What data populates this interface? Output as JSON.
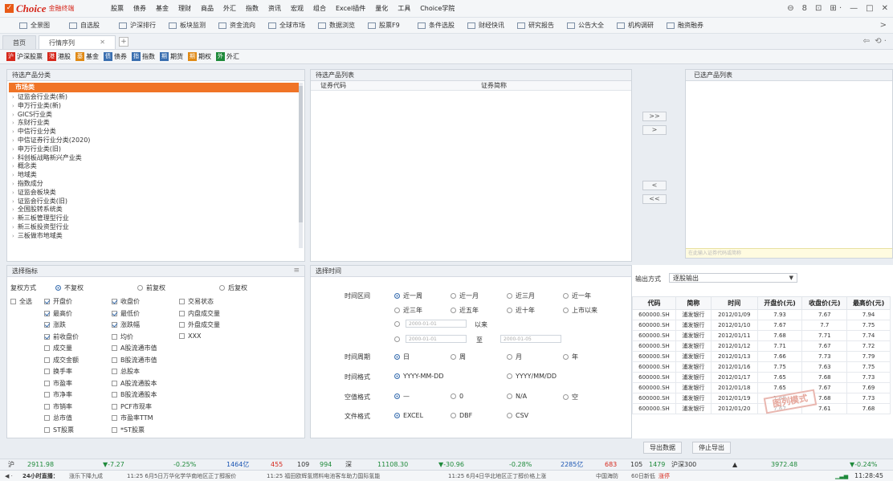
{
  "app": {
    "brand": "Choice",
    "brand_sub": "金融终端"
  },
  "menu": [
    "股票",
    "债券",
    "基金",
    "理财",
    "商品",
    "外汇",
    "指数",
    "资讯",
    "宏观",
    "组合",
    "Excel插件",
    "量化",
    "工具",
    "Choice学院"
  ],
  "window_controls": [
    "⊖",
    "8",
    "⊡",
    "⊞ ·",
    "—",
    "□",
    "✕"
  ],
  "toolbar": [
    "全景图",
    "自选股",
    "沪深排行",
    "板块监测",
    "资金流向",
    "全球市场",
    "数据浏览",
    "股票F9",
    "条件选股",
    "财经快讯",
    "研究报告",
    "公告大全",
    "机构调研",
    "融资融券"
  ],
  "toolbar_more": ">",
  "tabs": {
    "home": "首页",
    "active": "行情序列",
    "close": "✕",
    "add": "+"
  },
  "categories": [
    {
      "icon": "沪",
      "label": "沪深股票",
      "color": "#d6281c"
    },
    {
      "icon": "港",
      "label": "港股",
      "color": "#d6281c"
    },
    {
      "icon": "基",
      "label": "基金",
      "color": "#e08a16"
    },
    {
      "icon": "债",
      "label": "债券",
      "color": "#3a6fb0"
    },
    {
      "icon": "指",
      "label": "指数",
      "color": "#3a6fb0"
    },
    {
      "icon": "期",
      "label": "期货",
      "color": "#3a6fb0"
    },
    {
      "icon": "期",
      "label": "期权",
      "color": "#e08a16"
    },
    {
      "icon": "外",
      "label": "外汇",
      "color": "#1f8a3b"
    }
  ],
  "product_panel": {
    "title": "待选产品分类",
    "selected": "市场类",
    "items": [
      "证监会行业类(新)",
      "申万行业类(新)",
      "GICS行业类",
      "东财行业类",
      "中信行业分类",
      "中信证券行业分类(2020)",
      "申万行业类(旧)",
      "科创板战略新兴产业类",
      "概念类",
      "地域类",
      "指数成分",
      "证监会板块类",
      "证监会行业类(旧)",
      "全国股转系统类",
      "新三板管理型行业",
      "新三板投资型行业",
      "三板做市地域类"
    ]
  },
  "candidate_panel": {
    "title": "待选产品列表",
    "col_code": "证券代码",
    "col_name": "证券简称"
  },
  "chosen_panel": {
    "title": "已选产品列表",
    "placeholder": "在此输入证券代码或简称"
  },
  "arrow_buttons": [
    ">>",
    ">",
    "<",
    "<<"
  ],
  "indicator_panel": {
    "title": "选择指标",
    "rights_label": "复权方式",
    "rights": [
      {
        "label": "不复权",
        "on": true
      },
      {
        "label": "前复权",
        "on": false
      },
      {
        "label": "后复权",
        "on": false
      }
    ],
    "select_all": "全选",
    "col1": [
      {
        "label": "开盘价",
        "on": true
      },
      {
        "label": "最高价",
        "on": true
      },
      {
        "label": "涨跌",
        "on": true
      },
      {
        "label": "前收盘价",
        "on": true
      },
      {
        "label": "成交量",
        "on": false
      },
      {
        "label": "成交金额",
        "on": false
      },
      {
        "label": "换手率",
        "on": false
      },
      {
        "label": "市盈率",
        "on": false
      },
      {
        "label": "市净率",
        "on": false
      },
      {
        "label": "市销率",
        "on": false
      },
      {
        "label": "总市值",
        "on": false
      },
      {
        "label": "ST股票",
        "on": false
      }
    ],
    "col2": [
      {
        "label": "收盘价",
        "on": true
      },
      {
        "label": "最低价",
        "on": true
      },
      {
        "label": "涨跌幅",
        "on": true
      },
      {
        "label": "均价",
        "on": false
      },
      {
        "label": "A股流通市值",
        "on": false
      },
      {
        "label": "B股流通市值",
        "on": false
      },
      {
        "label": "总股本",
        "on": false
      },
      {
        "label": "A股流通股本",
        "on": false
      },
      {
        "label": "B股流通股本",
        "on": false
      },
      {
        "label": "PCF市现率",
        "on": false
      },
      {
        "label": "市盈率TTM",
        "on": false
      },
      {
        "label": "*ST股票",
        "on": false
      }
    ],
    "col3": [
      {
        "label": "交易状态",
        "on": false
      },
      {
        "label": "内盘成交量",
        "on": false
      },
      {
        "label": "外盘成交量",
        "on": false
      },
      {
        "label": "XXX",
        "on": false
      }
    ]
  },
  "time_panel": {
    "title": "选择时间",
    "range_label": "时间区间",
    "range_row1": [
      {
        "label": "近一周",
        "on": true
      },
      {
        "label": "近一月",
        "on": false
      },
      {
        "label": "近三月",
        "on": false
      },
      {
        "label": "近一年",
        "on": false
      }
    ],
    "range_row2": [
      {
        "label": "近三年",
        "on": false
      },
      {
        "label": "近五年",
        "on": false
      },
      {
        "label": "近十年",
        "on": false
      },
      {
        "label": "上市以来",
        "on": false
      }
    ],
    "date_from": "2000-01-01",
    "since": "以来",
    "date_to_start": "2000-01-01",
    "to": "至",
    "date_to_end": "2000-01-05",
    "period_label": "时间周期",
    "periods": [
      {
        "label": "日",
        "on": true
      },
      {
        "label": "周",
        "on": false
      },
      {
        "label": "月",
        "on": false
      },
      {
        "label": "年",
        "on": false
      }
    ],
    "format_label": "时间格式",
    "formats": [
      {
        "label": "YYYY-MM-DD",
        "on": true
      },
      {
        "label": "YYYY/MM/DD",
        "on": false
      }
    ],
    "empty_label": "空值格式",
    "empties": [
      {
        "label": "—",
        "on": true
      },
      {
        "label": "0",
        "on": false
      },
      {
        "label": "N/A",
        "on": false
      },
      {
        "label": "空",
        "on": false
      }
    ],
    "file_label": "文件格式",
    "files": [
      {
        "label": "EXCEL",
        "on": true
      },
      {
        "label": "DBF",
        "on": false
      },
      {
        "label": "CSV",
        "on": false
      }
    ]
  },
  "output_panel": {
    "mode_label": "输出方式",
    "mode_value": "逐股输出",
    "columns": [
      "代码",
      "简称",
      "时间",
      "开盘价(元)",
      "收盘价(元)",
      "最高价(元)"
    ],
    "rows": [
      [
        "600000.SH",
        "浦发银行",
        "2012/01/09",
        "7.93",
        "7.67",
        "7.94"
      ],
      [
        "600000.SH",
        "浦发银行",
        "2012/01/10",
        "7.67",
        "7.7",
        "7.75"
      ],
      [
        "600000.SH",
        "浦发银行",
        "2012/01/11",
        "7.68",
        "7.71",
        "7.74"
      ],
      [
        "600000.SH",
        "浦发银行",
        "2012/01/12",
        "7.71",
        "7.67",
        "7.72"
      ],
      [
        "600000.SH",
        "浦发银行",
        "2012/01/13",
        "7.66",
        "7.73",
        "7.79"
      ],
      [
        "600000.SH",
        "浦发银行",
        "2012/01/16",
        "7.75",
        "7.63",
        "7.75"
      ],
      [
        "600000.SH",
        "浦发银行",
        "2012/01/17",
        "7.65",
        "7.68",
        "7.73"
      ],
      [
        "600000.SH",
        "浦发银行",
        "2012/01/18",
        "7.65",
        "7.67",
        "7.69"
      ],
      [
        "600000.SH",
        "浦发银行",
        "2012/01/19",
        "7.68",
        "7.68",
        "7.73"
      ],
      [
        "600000.SH",
        "浦发银行",
        "2012/01/20",
        "7.67",
        "7.61",
        "7.68"
      ]
    ],
    "watermark": "图列模式",
    "export_btn": "导出数据",
    "stop_btn": "停止导出"
  },
  "ticker": {
    "market": "沪",
    "index": "2911.98",
    "change": "▼-7.27",
    "pct": "-0.25%",
    "amount": "1464亿",
    "n1": "455",
    "n2": "109",
    "n3": "994",
    "market2": "深",
    "index2": "11108.30",
    "change2": "▼-30.96",
    "pct2": "-0.28%",
    "amount2": "2285亿",
    "n4": "683",
    "n5": "105",
    "n6": "1479",
    "index3_name": "沪深300",
    "index3_arrow": "▲",
    "index3": "3972.48",
    "index3_pct": "▼-0.24%"
  },
  "newsbar": {
    "live": "24小时直播：",
    "items": [
      "涨乐下降九成",
      "11:25 6月5日万华化学华南地区正丁醇报价",
      "11:25 福田欧辉氢燃料电池客车助力国际氢能",
      "11:25 6月4日华北地区正丁醇价格上涨",
      "中国海防",
      "60日新低",
      "涨停"
    ],
    "time": "11:28:45"
  }
}
